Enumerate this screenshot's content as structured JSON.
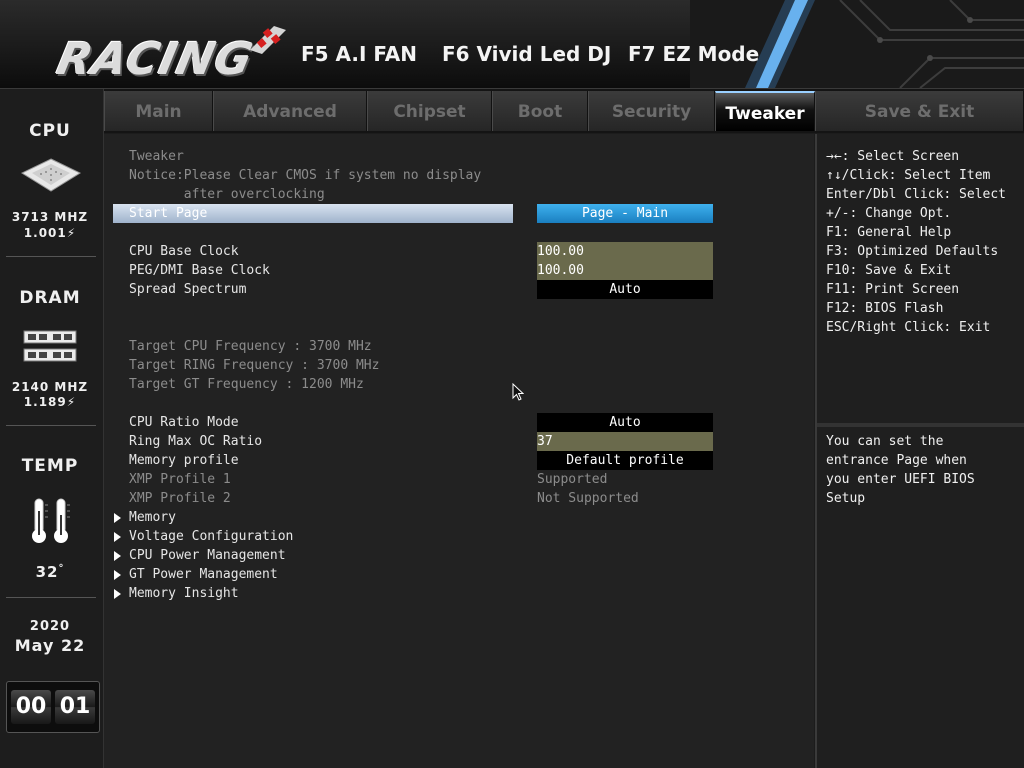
{
  "header": {
    "logo_text": "RACING",
    "f5_label": "F5 A.I FAN",
    "f6_label": "F6 Vivid Led DJ",
    "f7_label": "F7 EZ Mode"
  },
  "status": {
    "cpu_title": "CPU",
    "cpu_freq": "3713 MHZ",
    "cpu_volt": "1.001",
    "dram_title": "DRAM",
    "dram_freq": "2140 MHZ",
    "dram_volt": "1.189",
    "temp_title": "TEMP",
    "temp_value": "32",
    "temp_unit": "°",
    "year": "2020",
    "date": "May 22",
    "clock_hours": "00",
    "clock_minutes": "01"
  },
  "tabs": [
    {
      "label": "Main",
      "active": false
    },
    {
      "label": "Advanced",
      "active": false
    },
    {
      "label": "Chipset",
      "active": false
    },
    {
      "label": "Boot",
      "active": false
    },
    {
      "label": "Security",
      "active": false
    },
    {
      "label": "Tweaker",
      "active": true
    },
    {
      "label": "Save & Exit",
      "active": false
    }
  ],
  "main": {
    "section_title": "Tweaker",
    "notice_line1": "Notice:Please Clear CMOS if system no display",
    "notice_line2": "       after overclocking",
    "start_page_label": "Start Page",
    "start_page_value": "Page - Main",
    "cpu_base_clock_label": "CPU Base Clock",
    "cpu_base_clock_value": "100.00",
    "peg_dmi_label": "PEG/DMI Base Clock",
    "peg_dmi_value": "100.00",
    "spread_label": "Spread Spectrum",
    "spread_value": "Auto",
    "target_cpu": "Target CPU Frequency : 3700 MHz",
    "target_ring": "Target RING Frequency : 3700 MHz",
    "target_gt": "Target GT Frequency : 1200 MHz",
    "cpu_ratio_label": "CPU Ratio Mode",
    "cpu_ratio_value": "Auto",
    "ring_max_label": "Ring Max OC Ratio",
    "ring_max_value": "37",
    "mem_profile_label": "Memory profile",
    "mem_profile_value": "Default profile",
    "xmp1_label": "XMP Profile 1",
    "xmp1_value": "Supported",
    "xmp2_label": "XMP Profile 2",
    "xmp2_value": "Not Supported",
    "submenus": [
      "Memory",
      "Voltage Configuration",
      "CPU Power Management",
      "GT Power Management",
      "Memory Insight"
    ]
  },
  "help": {
    "keys": [
      "→←: Select Screen",
      "↑↓/Click: Select Item",
      "Enter/Dbl Click: Select",
      "+/-: Change Opt.",
      "F1: General Help",
      "F3: Optimized Defaults",
      "F10: Save & Exit",
      "F11: Print Screen",
      "F12: BIOS Flash",
      "ESC/Right Click: Exit"
    ],
    "description": [
      "You can set the",
      "entrance Page when",
      "you enter UEFI BIOS",
      "Setup"
    ]
  },
  "icons": {
    "cpu": "cpu-chip-icon",
    "dram": "ram-module-icon",
    "temp": "thermometer-icon",
    "bolt": "lightning-icon",
    "cursor": "mouse-pointer-icon",
    "submenu": "triangle-right-icon"
  },
  "colors": {
    "active_tab_accent": "#9ad0ff",
    "start_page_button": "#2a98d8",
    "editable_field": "#6a6a4c",
    "highlight_row": "#b8c8dc"
  }
}
